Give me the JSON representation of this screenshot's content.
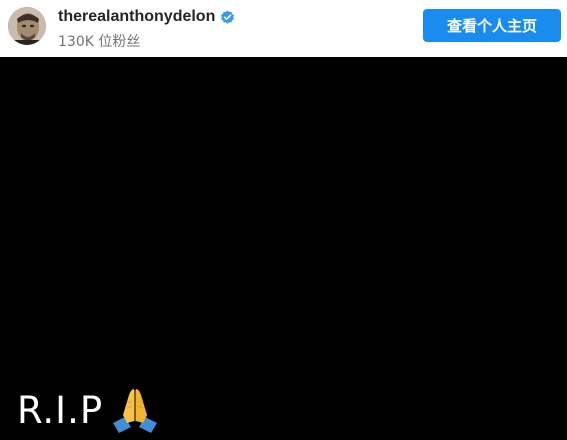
{
  "header": {
    "username": "therealanthonydelon",
    "verified_icon": "verified-badge-icon",
    "followers": "130K 位粉丝",
    "profile_button_label": "查看个人主页"
  },
  "post": {
    "caption": "R.I.P",
    "emoji_icon": "folded-hands-icon"
  },
  "colors": {
    "header_bg": "#ffffff",
    "button_bg": "#1a8cf0",
    "post_bg": "#000000",
    "verified": "#3897f0"
  }
}
